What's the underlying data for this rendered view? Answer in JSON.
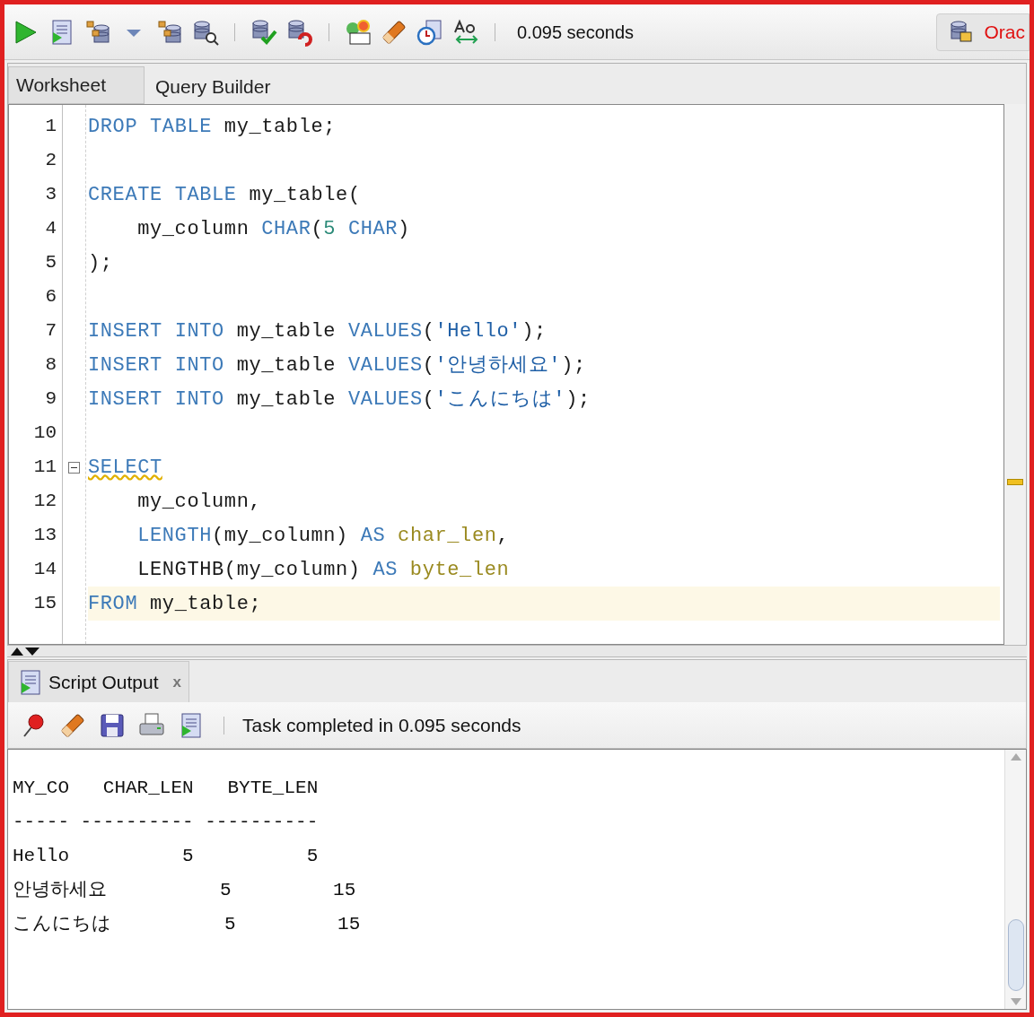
{
  "toolbar": {
    "timing": "0.095 seconds",
    "connection": "Orac"
  },
  "editor_tabs": [
    {
      "label": "Worksheet",
      "selected": true
    },
    {
      "label": "Query Builder",
      "selected": false
    }
  ],
  "code_lines": [
    {
      "number": "1",
      "current": false,
      "fold": false,
      "tokens": [
        {
          "text": "DROP",
          "kind": "keyword"
        },
        {
          "text": " TABLE",
          "kind": "keyword"
        },
        {
          "text": " my_table;",
          "kind": "plain"
        }
      ]
    },
    {
      "number": "2",
      "current": false,
      "fold": false
    },
    {
      "number": "3",
      "current": false,
      "fold": false,
      "tokens": [
        {
          "text": "CREATE",
          "kind": "keyword"
        },
        {
          "text": " TABLE",
          "kind": "keyword"
        },
        {
          "text": " my_table(",
          "kind": "plain"
        }
      ]
    },
    {
      "number": "4",
      "current": false,
      "fold": false,
      "tokens": [
        {
          "text": "    my_column ",
          "kind": "plain"
        },
        {
          "text": "CHAR",
          "kind": "keyword"
        },
        {
          "text": "(",
          "kind": "plain"
        },
        {
          "text": "5",
          "kind": "number"
        },
        {
          "text": " CHAR",
          "kind": "keyword"
        },
        {
          "text": ")",
          "kind": "plain"
        }
      ]
    },
    {
      "number": "5",
      "current": false,
      "fold": false,
      "tokens": [
        {
          "text": ");",
          "kind": "plain"
        }
      ]
    },
    {
      "number": "6",
      "current": false,
      "fold": false
    },
    {
      "number": "7",
      "current": false,
      "fold": false,
      "tokens": [
        {
          "text": "INSERT",
          "kind": "keyword"
        },
        {
          "text": " INTO",
          "kind": "keyword"
        },
        {
          "text": " my_table ",
          "kind": "plain"
        },
        {
          "text": "VALUES",
          "kind": "keyword"
        },
        {
          "text": "(",
          "kind": "plain"
        },
        {
          "text": "'Hello'",
          "kind": "string"
        },
        {
          "text": ");",
          "kind": "plain"
        }
      ]
    },
    {
      "number": "8",
      "current": false,
      "fold": false,
      "tokens": [
        {
          "text": "INSERT",
          "kind": "keyword"
        },
        {
          "text": " INTO",
          "kind": "keyword"
        },
        {
          "text": " my_table ",
          "kind": "plain"
        },
        {
          "text": "VALUES",
          "kind": "keyword"
        },
        {
          "text": "(",
          "kind": "plain"
        },
        {
          "text": "'안녕하세요'",
          "kind": "string"
        },
        {
          "text": ");",
          "kind": "plain"
        }
      ]
    },
    {
      "number": "9",
      "current": false,
      "fold": false,
      "tokens": [
        {
          "text": "INSERT",
          "kind": "keyword"
        },
        {
          "text": " INTO",
          "kind": "keyword"
        },
        {
          "text": " my_table ",
          "kind": "plain"
        },
        {
          "text": "VALUES",
          "kind": "keyword"
        },
        {
          "text": "(",
          "kind": "plain"
        },
        {
          "text": "'こんにちは'",
          "kind": "string"
        },
        {
          "text": ");",
          "kind": "plain"
        }
      ]
    },
    {
      "number": "10",
      "current": false,
      "fold": false
    },
    {
      "number": "11",
      "current": false,
      "fold": true,
      "tokens": [
        {
          "text": "SELECT",
          "kind": "warning"
        }
      ]
    },
    {
      "number": "12",
      "current": false,
      "fold": false,
      "tokens": [
        {
          "text": "    my_column,",
          "kind": "plain"
        }
      ]
    },
    {
      "number": "13",
      "current": false,
      "fold": false,
      "tokens": [
        {
          "text": "    LENGTH",
          "kind": "keyword"
        },
        {
          "text": "(my_column) ",
          "kind": "plain"
        },
        {
          "text": "AS",
          "kind": "keyword"
        },
        {
          "text": " char_len",
          "kind": "alias"
        },
        {
          "text": ",",
          "kind": "plain"
        }
      ]
    },
    {
      "number": "14",
      "current": false,
      "fold": false,
      "tokens": [
        {
          "text": "    LENGTHB(my_column) ",
          "kind": "plain"
        },
        {
          "text": "AS",
          "kind": "keyword"
        },
        {
          "text": " byte_len",
          "kind": "alias"
        }
      ]
    },
    {
      "number": "15",
      "current": true,
      "fold": false,
      "tokens": [
        {
          "text": "FROM",
          "kind": "keyword"
        },
        {
          "text": " my_table;",
          "kind": "plain"
        }
      ]
    }
  ],
  "output_tab": {
    "label": "Script Output",
    "close": "x"
  },
  "output_status": "Task completed in 0.095 seconds",
  "output_lines": [
    "MY_CO   CHAR_LEN   BYTE_LEN",
    "----- ---------- ----------",
    "Hello          5          5",
    "안녕하세요          5         15",
    "こんにちは          5         15"
  ]
}
